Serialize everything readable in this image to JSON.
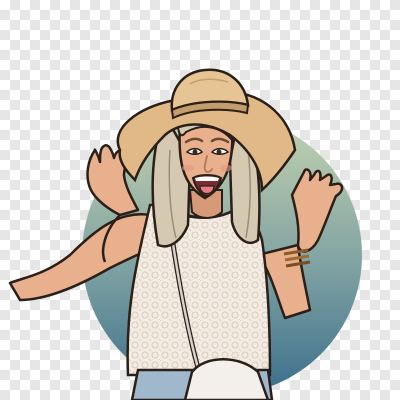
{
  "image": {
    "subject": "cartoon-portrait",
    "background": "transparency-checkerboard",
    "colors": {
      "circle_top": "#c4d3b0",
      "circle_bottom": "#3c6f8c",
      "skin": "#e9b08d",
      "skin_shadow": "#c98666",
      "hair": "#d6c9b2",
      "hair_shadow": "#9b8d78",
      "hat": "#e0b987",
      "hat_band": "#c59d6c",
      "top": "#f2ebe2",
      "jeans": "#9fb8cc",
      "bag": "#f3f0ec",
      "outline": "#2b1f1a"
    }
  }
}
